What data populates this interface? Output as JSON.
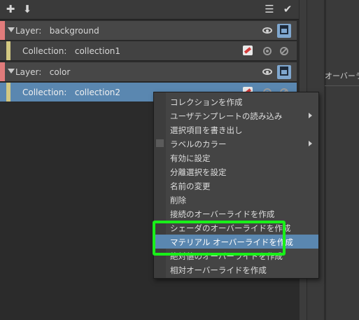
{
  "toolbar": {
    "icons": [
      "add-layer-icon",
      "import-icon",
      "stack-icon",
      "checklist-icon"
    ]
  },
  "layers": [
    {
      "label": "Layer:   background",
      "collections": [
        {
          "label": "Collection:   collection1",
          "selected": false
        }
      ]
    },
    {
      "label": "Layer:   color",
      "collections": [
        {
          "label": "Collection:   collection2",
          "selected": true
        }
      ]
    }
  ],
  "side_panel": {
    "label": "オーバーラ"
  },
  "context_menu": {
    "items": [
      {
        "label": "コレクションを作成"
      },
      {
        "label": "ユーザテンプレートの読み込み",
        "submenu": true
      },
      {
        "label": "選択項目を書き出し"
      },
      {
        "label": "ラベルのカラー",
        "submenu": true
      },
      {
        "label": "有効に設定"
      },
      {
        "label": "分離選択を設定"
      },
      {
        "label": "名前の変更"
      },
      {
        "label": "削除"
      },
      {
        "label": "接続のオーバーライドを作成"
      },
      {
        "label": "シェーダのオーバーライドを作成"
      },
      {
        "label": "マテリアル オーバーライドを作成",
        "highlighted": true
      },
      {
        "label": "絶対値のオーバーライドを作成"
      },
      {
        "label": "相対オーバーライドを作成"
      }
    ]
  },
  "colors": {
    "selection": "#5a87b0",
    "annotation_box": "#19f019",
    "layer_strip": "#e07b7b",
    "collection_strip": "#d2c882"
  }
}
